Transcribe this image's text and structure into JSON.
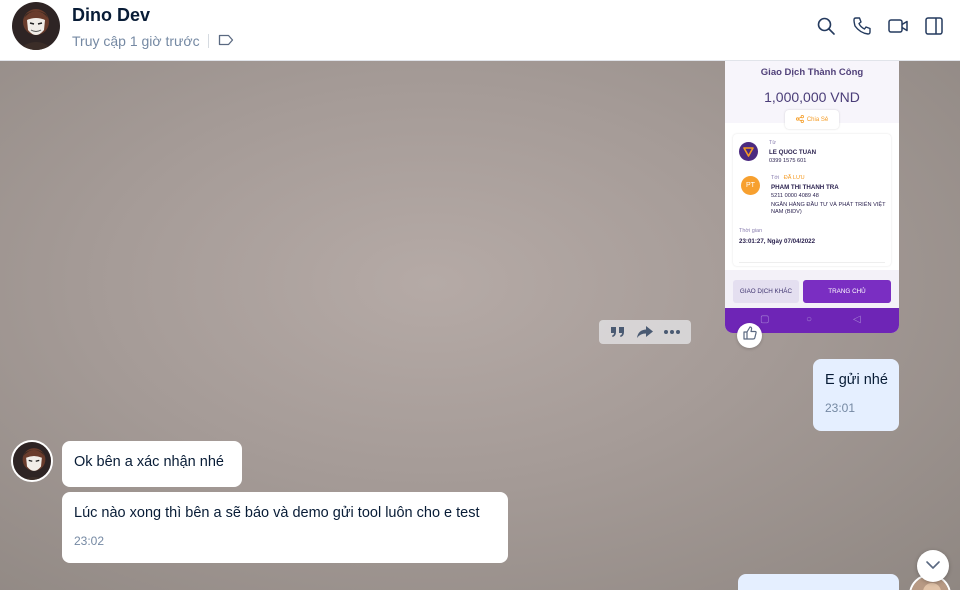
{
  "header": {
    "contact_name": "Dino Dev",
    "status": "Truy cập 1 giờ trước",
    "icons": [
      "search-icon",
      "phone-icon",
      "video-call-icon",
      "sidebar-toggle-icon"
    ]
  },
  "shared_image": {
    "title": "Giao Dịch Thành Công",
    "amount": "1,000,000 VND",
    "share_label": "Chia Sẻ",
    "from_label": "Từ",
    "from_name": "LE QUOC TUAN",
    "from_account": "0399 1575 601",
    "to_label": "Tới",
    "to_tag": "ĐÃ LƯU",
    "to_initials": "PT",
    "to_name": "PHAM THI THANH TRA",
    "to_account": "5211 0000 4089 48",
    "to_bank": "NGÂN HÀNG ĐẦU TƯ VÀ PHÁT TRIỂN VIỆT NAM (BIDV)",
    "time_label": "Thời gian",
    "time_value": "23:01:27, Ngày 07/04/2022",
    "btn_other": "GIAO DỊCH KHÁC",
    "btn_home": "TRANG CHỦ",
    "brand_color": "#6e25b6",
    "accent_color": "#f59b23"
  },
  "messages": [
    {
      "sender": "me",
      "text": "E gửi nhé",
      "time": "23:01"
    },
    {
      "sender": "them",
      "text": "Ok bên a xác nhận nhé"
    },
    {
      "sender": "them",
      "text": "Lúc nào xong thì bên a sẽ báo và demo gửi tool luôn cho e test",
      "time": "23:02"
    }
  ],
  "colors": {
    "my_bubble": "#e5efff",
    "their_bubble": "#ffffff",
    "time_text": "#7589a3"
  }
}
